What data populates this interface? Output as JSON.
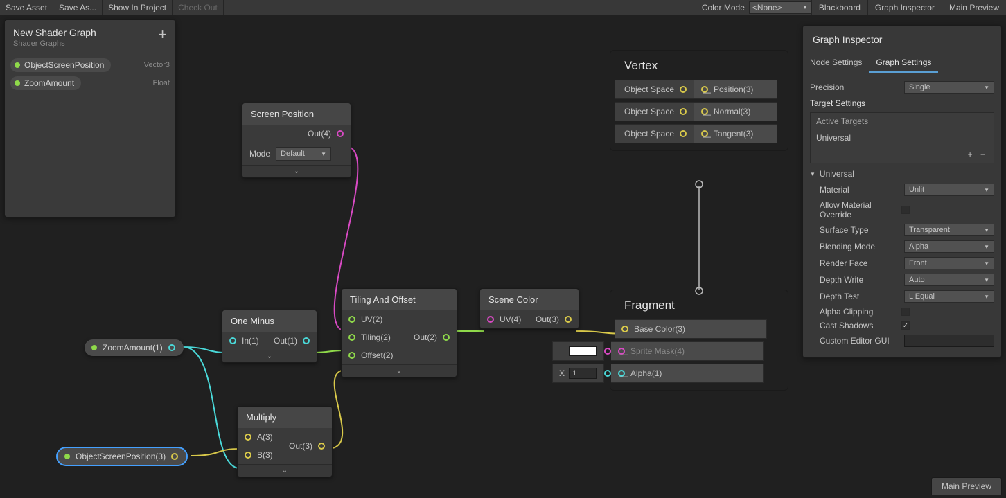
{
  "toolbar": {
    "save": "Save Asset",
    "saveAs": "Save As...",
    "showInProject": "Show In Project",
    "checkOut": "Check Out",
    "colorModeLabel": "Color Mode",
    "colorModeValue": "<None>",
    "blackboard": "Blackboard",
    "graphInspector": "Graph Inspector",
    "mainPreview": "Main Preview"
  },
  "blackboard": {
    "title": "New Shader Graph",
    "subtitle": "Shader Graphs",
    "props": [
      {
        "name": "ObjectScreenPosition",
        "type": "Vector3"
      },
      {
        "name": "ZoomAmount",
        "type": "Float"
      }
    ]
  },
  "nodes": {
    "screenPosition": {
      "title": "Screen Position",
      "out": "Out(4)",
      "modeLabel": "Mode",
      "modeValue": "Default"
    },
    "oneMinus": {
      "title": "One Minus",
      "in": "In(1)",
      "out": "Out(1)"
    },
    "multiply": {
      "title": "Multiply",
      "a": "A(3)",
      "b": "B(3)",
      "out": "Out(3)"
    },
    "tilingOffset": {
      "title": "Tiling And Offset",
      "uv": "UV(2)",
      "tiling": "Tiling(2)",
      "offset": "Offset(2)",
      "out": "Out(2)"
    },
    "sceneColor": {
      "title": "Scene Color",
      "uv": "UV(4)",
      "out": "Out(3)"
    },
    "zoomAmountRef": "ZoomAmount(1)",
    "objScreenPosRef": "ObjectScreenPosition(3)"
  },
  "vertex": {
    "title": "Vertex",
    "slots": [
      {
        "space": "Object Space",
        "name": "Position(3)"
      },
      {
        "space": "Object Space",
        "name": "Normal(3)"
      },
      {
        "space": "Object Space",
        "name": "Tangent(3)"
      }
    ]
  },
  "fragment": {
    "title": "Fragment",
    "baseColor": "Base Color(3)",
    "spriteMask": "Sprite Mask(4)",
    "alpha": "Alpha(1)",
    "xLabel": "X",
    "xValue": "1"
  },
  "inspector": {
    "title": "Graph Inspector",
    "tabs": {
      "node": "Node Settings",
      "graph": "Graph Settings"
    },
    "precisionLabel": "Precision",
    "precisionValue": "Single",
    "targetSettings": "Target Settings",
    "activeTargets": "Active Targets",
    "targetName": "Universal",
    "fold": "Universal",
    "rows": {
      "material": {
        "label": "Material",
        "value": "Unlit"
      },
      "allowOverride": {
        "label": "Allow Material Override",
        "checked": false
      },
      "surface": {
        "label": "Surface Type",
        "value": "Transparent"
      },
      "blending": {
        "label": "Blending Mode",
        "value": "Alpha"
      },
      "renderFace": {
        "label": "Render Face",
        "value": "Front"
      },
      "depthWrite": {
        "label": "Depth Write",
        "value": "Auto"
      },
      "depthTest": {
        "label": "Depth Test",
        "value": "L Equal"
      },
      "alphaClip": {
        "label": "Alpha Clipping",
        "checked": false
      },
      "castShadows": {
        "label": "Cast Shadows",
        "checked": true
      },
      "customGUI": {
        "label": "Custom Editor GUI"
      }
    }
  },
  "previewLabel": "Main Preview"
}
